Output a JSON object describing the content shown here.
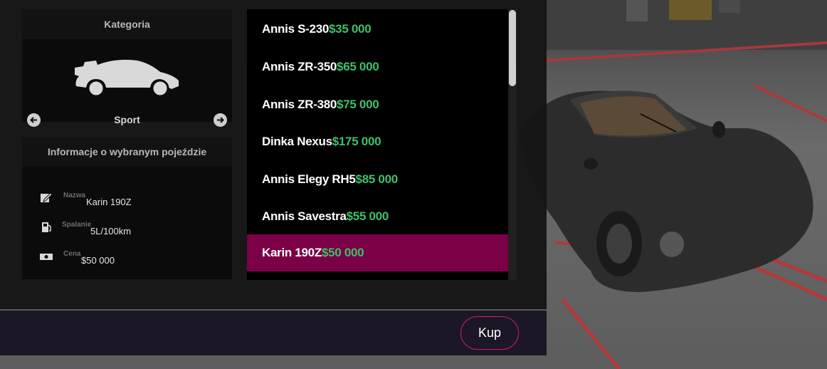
{
  "category": {
    "title": "Kategoria",
    "current": "Sport",
    "prev_icon": "arrow-left-icon",
    "next_icon": "arrow-right-icon",
    "car_icon": "sports-car-icon"
  },
  "info": {
    "title": "Informacje o wybranym pojeździe",
    "rows": [
      {
        "icon": "edit-icon",
        "label": "Nazwa",
        "value": "Karin 190Z"
      },
      {
        "icon": "fuel-pump-icon",
        "label": "Spalanie",
        "value": "5L/100km"
      },
      {
        "icon": "banknote-icon",
        "label": "Cena",
        "value": "$50 000"
      }
    ]
  },
  "vehicles": [
    {
      "name": "Annis S-230",
      "price": "$35 000"
    },
    {
      "name": "Annis ZR-350",
      "price": "$65 000"
    },
    {
      "name": "Annis ZR-380",
      "price": "$75 000"
    },
    {
      "name": "Dinka Nexus",
      "price": "$175 000"
    },
    {
      "name": "Annis Elegy RH5",
      "price": "$85 000"
    },
    {
      "name": "Annis Savestra",
      "price": "$55 000"
    },
    {
      "name": "Karin 190Z",
      "price": "$50 000",
      "selected": true
    }
  ],
  "footer": {
    "buy_label": "Kup"
  },
  "colors": {
    "accent": "#7b0046",
    "button_border": "#d11a7a",
    "price": "#3fbf6a"
  }
}
